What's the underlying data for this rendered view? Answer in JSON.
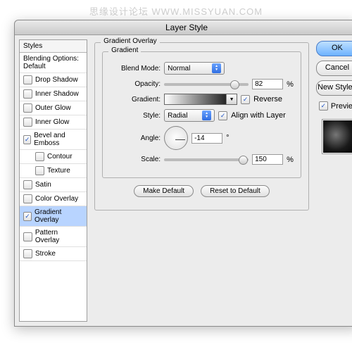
{
  "watermark": "思缘设计论坛   WWW.MISSYUAN.COM",
  "window": {
    "title": "Layer Style"
  },
  "sidebar": {
    "header": "Styles",
    "blending": "Blending Options: Default",
    "items": [
      {
        "label": "Drop Shadow",
        "checked": false
      },
      {
        "label": "Inner Shadow",
        "checked": false
      },
      {
        "label": "Outer Glow",
        "checked": false
      },
      {
        "label": "Inner Glow",
        "checked": false
      },
      {
        "label": "Bevel and Emboss",
        "checked": true
      },
      {
        "label": "Contour",
        "checked": false,
        "sub": true
      },
      {
        "label": "Texture",
        "checked": false,
        "sub": true
      },
      {
        "label": "Satin",
        "checked": false
      },
      {
        "label": "Color Overlay",
        "checked": false
      },
      {
        "label": "Gradient Overlay",
        "checked": true,
        "selected": true
      },
      {
        "label": "Pattern Overlay",
        "checked": false
      },
      {
        "label": "Stroke",
        "checked": false
      }
    ]
  },
  "panel": {
    "group_title": "Gradient Overlay",
    "subgroup_title": "Gradient",
    "blend_mode": {
      "label": "Blend Mode:",
      "value": "Normal"
    },
    "opacity": {
      "label": "Opacity:",
      "value": "82",
      "unit": "%"
    },
    "gradient": {
      "label": "Gradient:",
      "reverse_label": "Reverse",
      "reverse": true
    },
    "style": {
      "label": "Style:",
      "value": "Radial",
      "align_label": "Align with Layer",
      "align": true
    },
    "angle": {
      "label": "Angle:",
      "value": "-14",
      "unit": "°"
    },
    "scale": {
      "label": "Scale:",
      "value": "150",
      "unit": "%"
    },
    "make_default": "Make Default",
    "reset": "Reset to Default"
  },
  "buttons": {
    "ok": "OK",
    "cancel": "Cancel",
    "new_style": "New Style..",
    "preview": "Preview"
  }
}
